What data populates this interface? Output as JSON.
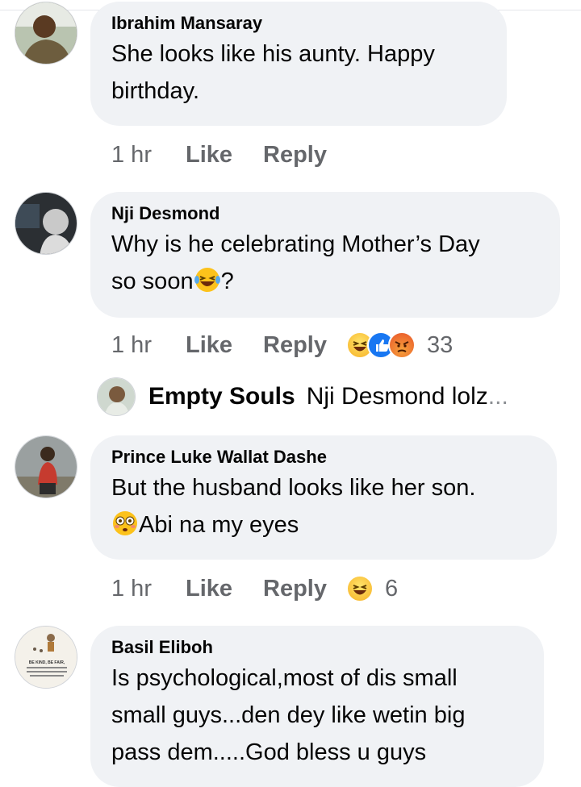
{
  "comments": [
    {
      "author": "Ibrahim Mansaray",
      "lines": [
        "She looks like his aunty. Happy",
        "birthday."
      ],
      "time": "1 hr",
      "like": "Like",
      "reply": "Reply"
    },
    {
      "author": "Nji Desmond",
      "line1": "Why is he celebrating Mother’s Day",
      "line2_before": "so soon",
      "line2_emoji": "laughing-tears-emoji",
      "line2_after": "?",
      "time": "1 hr",
      "like": "Like",
      "reply": "Reply",
      "reactions": [
        "haha-icon",
        "like-icon",
        "angry-icon"
      ],
      "reaction_count": "33",
      "reply_preview": {
        "author": "Empty Souls",
        "text": "Nji Desmond lolz",
        "ellipsis": "..."
      }
    },
    {
      "author": "Prince Luke Wallat Dashe",
      "line1": "But the husband looks like her son.",
      "line2_emoji": "flushed-emoji",
      "line2_after": "Abi na my eyes",
      "time": "1 hr",
      "like": "Like",
      "reply": "Reply",
      "reactions": [
        "haha-icon"
      ],
      "reaction_count": "6"
    },
    {
      "author": "Basil Eliboh",
      "lines": [
        "Is psychological,most of dis small",
        "small guys...den dey like wetin big",
        "pass dem.....God bless u guys"
      ],
      "avatar_caption": "BE KIND, BE FAIR,"
    }
  ],
  "colors": {
    "bubble": "#f0f2f5",
    "text": "#050505",
    "meta": "#65676b",
    "like_blue": "#1877f2"
  }
}
